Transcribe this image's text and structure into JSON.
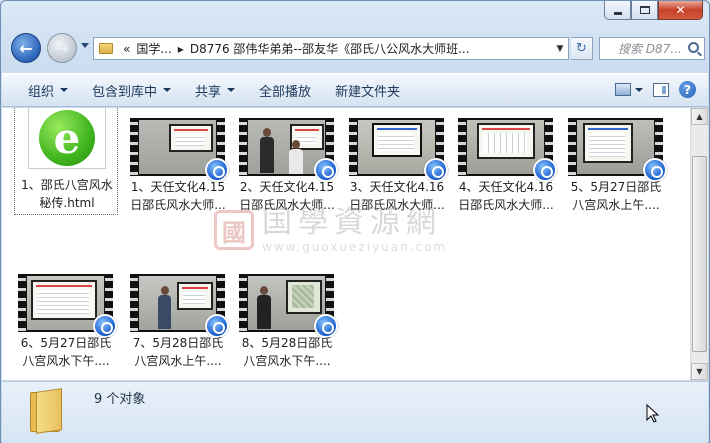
{
  "window": {
    "caption_buttons": [
      "minimize",
      "maximize",
      "close"
    ],
    "close_glyph": "✕"
  },
  "nav": {
    "back_glyph": "←",
    "forward_glyph": "→",
    "address_chevron": "«",
    "breadcrumb": [
      "国学...",
      "D8776 邵伟华弟弟--邵友华《邵氏八公风水大师班..."
    ],
    "breadcrumb_sep": "▸",
    "refresh_glyph": "↻",
    "search_placeholder": "搜索 D87..."
  },
  "toolbar": {
    "organize": "组织",
    "include_in_library": "包含到库中",
    "share": "共享",
    "play_all": "全部播放",
    "new_folder": "新建文件夹"
  },
  "files": [
    {
      "name": "1、邵氏八宫风水\n秘传.html",
      "type": "html"
    },
    {
      "name": "1、天任文化4.15\n日邵氏风水大师...",
      "type": "video"
    },
    {
      "name": "2、天任文化4.15\n日邵氏风水大师...",
      "type": "video"
    },
    {
      "name": "3、天任文化4.16\n日邵氏风水大师...",
      "type": "video"
    },
    {
      "name": "4、天任文化4.16\n日邵氏风水大师...",
      "type": "video"
    },
    {
      "name": "5、5月27日邵氏\n八宫风水上午....",
      "type": "video"
    },
    {
      "name": "6、5月27日邵氏\n八宫风水下午....",
      "type": "video"
    },
    {
      "name": "7、5月28日邵氏\n八宫风水上午....",
      "type": "video"
    },
    {
      "name": "8、5月28日邵氏\n八宫风水下午....",
      "type": "video"
    }
  ],
  "watermark": {
    "seal": "國",
    "title": "国學資源網",
    "url": "www.guoxueziyuan.com"
  },
  "status": {
    "item_count": "9 个对象"
  }
}
